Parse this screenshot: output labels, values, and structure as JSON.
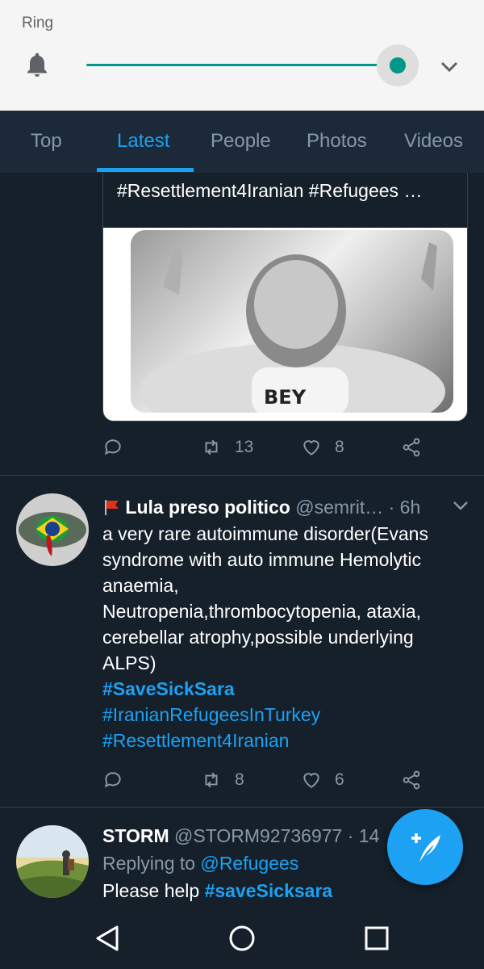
{
  "volume": {
    "title": "Ring",
    "level": 1.0,
    "accent": "#009688",
    "icon": "bell-icon",
    "expand_icon": "chevron-down-icon"
  },
  "tabs": [
    {
      "label": "Top",
      "active": false
    },
    {
      "label": "Latest",
      "active": true
    },
    {
      "label": "People",
      "active": false
    },
    {
      "label": "Photos",
      "active": false
    },
    {
      "label": "Videos",
      "active": false
    }
  ],
  "tweet1": {
    "quote_text": "#Resettlement4Iranian #Refugees …",
    "actions": {
      "retweets": "13",
      "likes": "8"
    }
  },
  "tweet2": {
    "flag_icon": "red-flag-emoji",
    "name": "Lula preso politico",
    "handle": "@semrit…",
    "time": "· 6h",
    "body_lines": [
      "a very rare autoimmune disorder(Evans",
      "syndrome with auto immune  Hemolytic",
      "anaemia,",
      "Neutropenia,thrombocytopenia, ataxia,",
      "cerebellar atrophy,possible underlying",
      "ALPS)"
    ],
    "hashtags": [
      "#SaveSickSara",
      "#IranianRefugeesInTurkey",
      "#Resettlement4Iranian"
    ],
    "actions": {
      "retweets": "8",
      "likes": "6"
    }
  },
  "tweet3": {
    "name": "STORM",
    "handle": "@STORM92736977",
    "time": "· 14",
    "replying_prefix": "Replying to",
    "replying_to": "@Refugees",
    "body_text": "Please help",
    "body_tag": "#saveSicksara"
  },
  "colors": {
    "background": "#15202b",
    "tab_bar": "#1c2938",
    "accent": "#1da1f2",
    "muted": "#8899a6"
  }
}
